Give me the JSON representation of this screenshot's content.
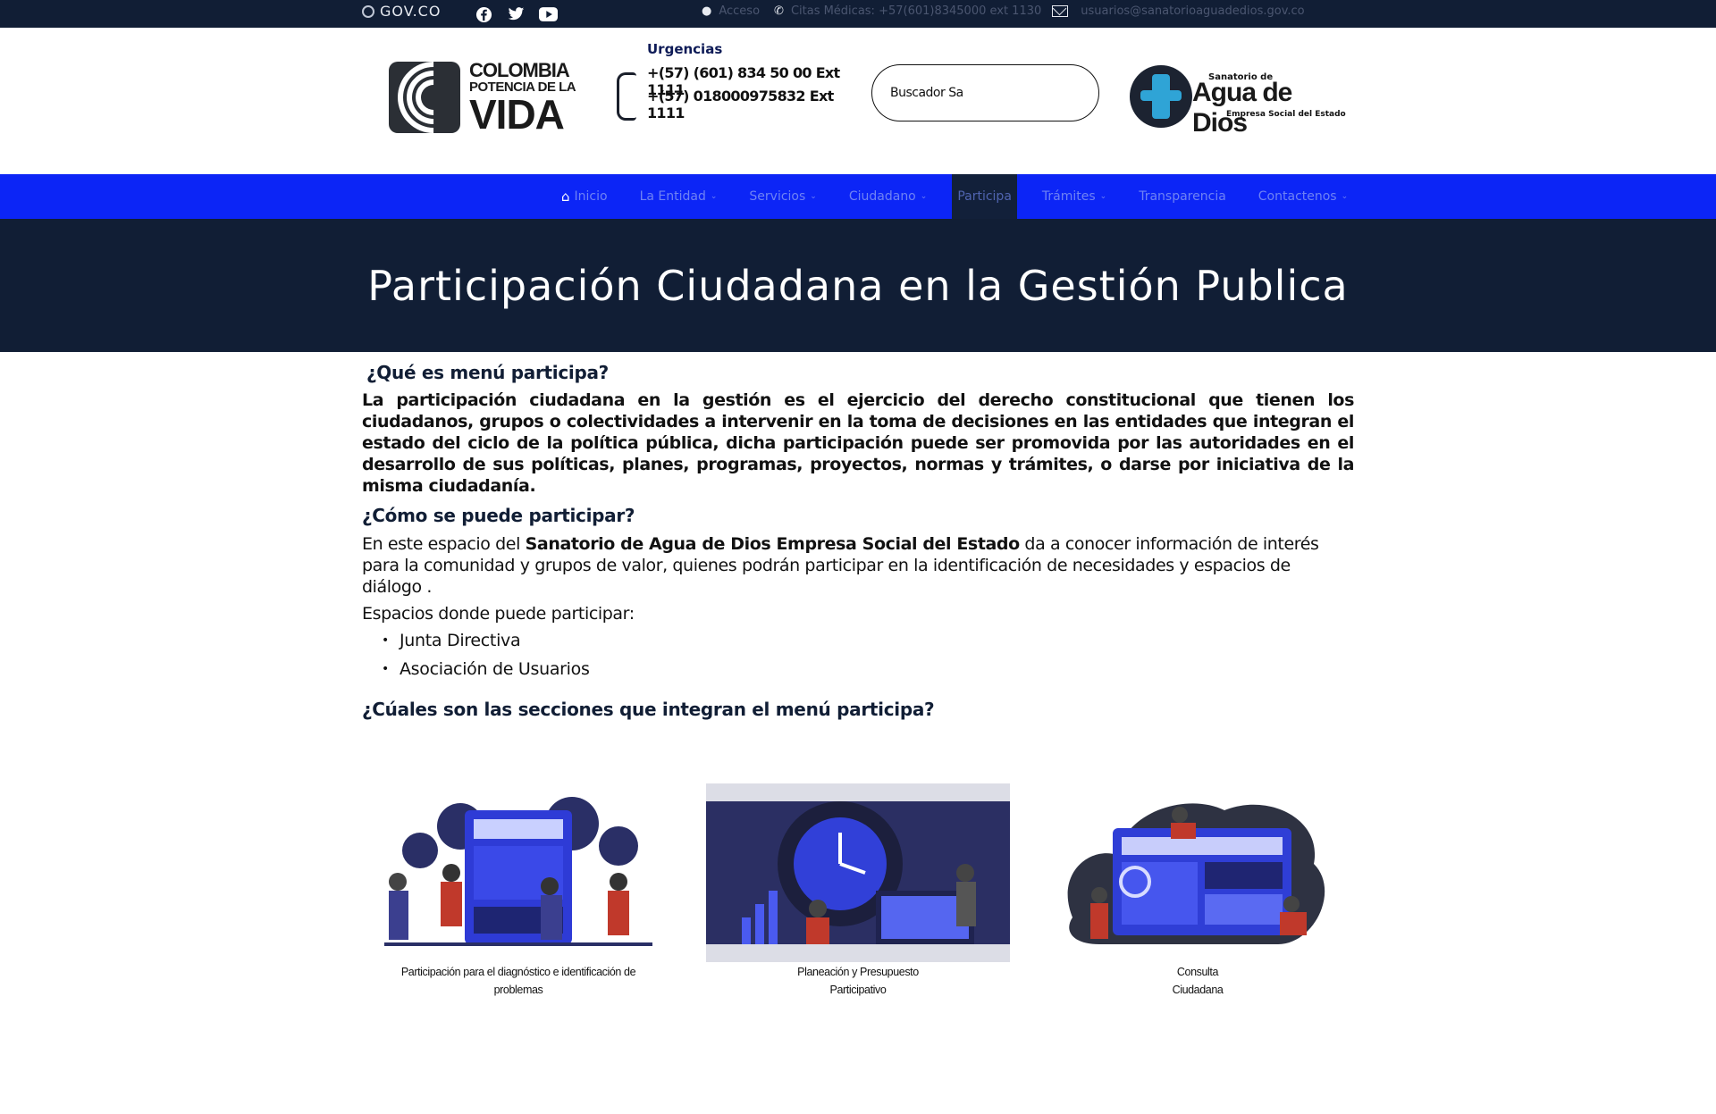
{
  "topbar": {
    "govco": "GOV.CO",
    "social": [
      "facebook-icon",
      "twitter-icon",
      "youtube-icon"
    ],
    "access": "Acceso",
    "citas": "Citas Médicas: +57(601)8345000 ext 1130",
    "email": "usuarios@sanatorioaguadedios.gov.co"
  },
  "header": {
    "colombia_logo": {
      "line1": "COLOMBIA",
      "line2": "POTENCIA DE LA",
      "line3": "VIDA"
    },
    "urgencias": {
      "title": "Urgencias",
      "phone1": "+(57) (601) 834 50 00 Ext 1111",
      "phone2": "+(57) 018000975832 Ext 1111"
    },
    "search": {
      "placeholder": "Buscador Sa"
    },
    "sanatorio_logo": {
      "line1": "Sanatorio de",
      "line2": "Agua de Dios",
      "line3": "Empresa Social del Estado"
    }
  },
  "nav": {
    "items": [
      {
        "label": "Inicio"
      },
      {
        "label": "La Entidad"
      },
      {
        "label": "Servicios"
      },
      {
        "label": "Ciudadano"
      },
      {
        "label": "Participa"
      },
      {
        "label": "Trámites"
      },
      {
        "label": "Transparencia"
      },
      {
        "label": "Contactenos"
      }
    ]
  },
  "hero": {
    "title": "Participación Ciudadana en la Gestión Publica"
  },
  "content": {
    "q1": "¿Qué es menú participa?",
    "para1": "La participación ciudadana en la gestión es el ejercicio del derecho constitucional que tienen los ciudadanos, grupos o colectividades a intervenir en la toma de decisiones en las entidades que integran el estado del ciclo de la política pública, dicha participación puede ser promovida por las autoridades en el desarrollo de sus políticas, planes, programas, proyectos, normas y trámites, o darse por iniciativa de la misma ciudadanía.",
    "q2": "¿Cómo se puede participar?",
    "para2_pre": "En este espacio del ",
    "para2_bold": "Sanatorio de Agua de Dios Empresa Social del Estado",
    "para2_post": " da a conocer información de interés para la comunidad y grupos de valor, quienes podrán participar en la identificación de necesidades y espacios de diálogo .",
    "espacios": "Espacios donde puede participar:",
    "list": [
      "Junta Directiva",
      "Asociación de Usuarios"
    ],
    "q3": "¿Cúales son las secciones que integran el menú participa?"
  },
  "cards": [
    {
      "caption_l1": "Participación para el diagnóstico e identificación de",
      "caption_l2": "problemas"
    },
    {
      "caption_l1": "Planeación y Presupuesto",
      "caption_l2": "Participativo"
    },
    {
      "caption_l1": "Consulta",
      "caption_l2": "Ciudadana"
    }
  ],
  "colors": {
    "nav": "#0c25f6",
    "dark": "#111e35",
    "accent": "#2fa4d6"
  }
}
